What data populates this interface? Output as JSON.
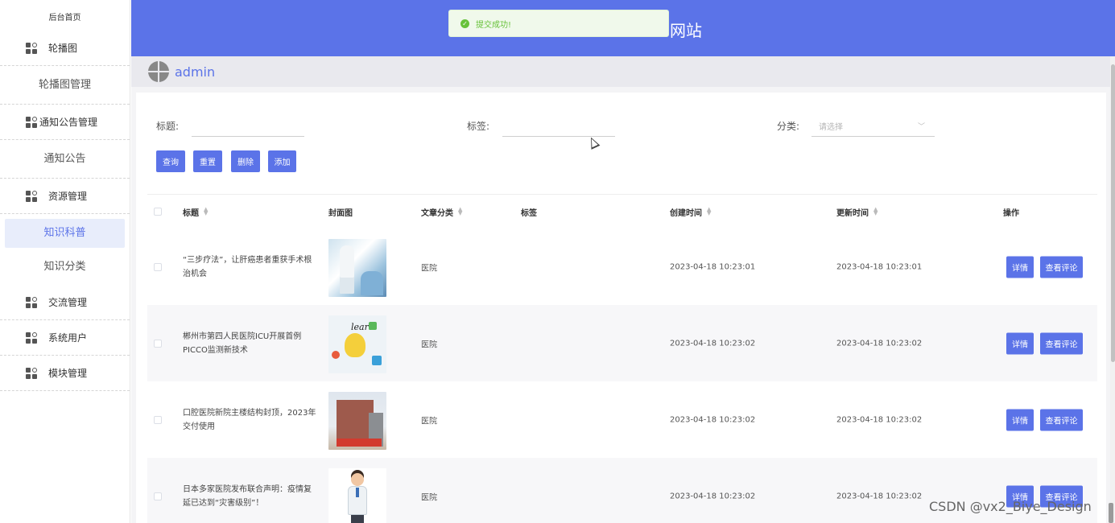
{
  "sidebar": {
    "home": "后台首页",
    "groups": [
      {
        "label": "轮播图",
        "icon": "grid-icon"
      },
      {
        "label": "通知公告管理",
        "icon": "grid-icon"
      },
      {
        "label": "资源管理",
        "icon": "grid-icon"
      },
      {
        "label": "交流管理",
        "icon": "grid-icon"
      },
      {
        "label": "系统用户",
        "icon": "grid-icon"
      },
      {
        "label": "模块管理",
        "icon": "grid-icon"
      }
    ],
    "subs": {
      "carousel_manage": "轮播图管理",
      "notice": "通知公告",
      "knowledge": "知识科普",
      "knowledge_category": "知识分类"
    }
  },
  "header": {
    "site_title": "网站",
    "toast": "提交成功!",
    "username": "admin"
  },
  "filters": {
    "title_label": "标题:",
    "tag_label": "标签:",
    "category_label": "分类:",
    "category_placeholder": "请选择"
  },
  "actions": {
    "query": "查询",
    "reset": "重置",
    "delete": "删除",
    "add": "添加"
  },
  "table": {
    "columns": {
      "title": "标题",
      "cover": "封面图",
      "category": "文章分类",
      "tag": "标签",
      "created": "创建时间",
      "updated": "更新时间",
      "ops": "操作"
    },
    "rows": [
      {
        "title": "“三步疗法”，让肝癌患者重获手术根治机会",
        "category": "医院",
        "tag": "",
        "created": "2023-04-18 10:23:01",
        "updated": "2023-04-18 10:23:01",
        "detail": "详情",
        "comments": "查看评论"
      },
      {
        "title": "郴州市第四人民医院ICU开展首例PICCO监测新技术",
        "category": "医院",
        "tag": "",
        "created": "2023-04-18 10:23:02",
        "updated": "2023-04-18 10:23:02",
        "detail": "详情",
        "comments": "查看评论"
      },
      {
        "title": "口腔医院新院主楼结构封顶，2023年交付使用",
        "category": "医院",
        "tag": "",
        "created": "2023-04-18 10:23:02",
        "updated": "2023-04-18 10:23:02",
        "detail": "详情",
        "comments": "查看评论"
      },
      {
        "title": "日本多家医院发布联合声明：疫情复延已达到“灾害级别”！",
        "category": "医院",
        "tag": "",
        "created": "2023-04-18 10:23:02",
        "updated": "2023-04-18 10:23:02",
        "detail": "详情",
        "comments": "查看评论"
      }
    ]
  },
  "watermark": "CSDN @vx2_Biye_Design",
  "colors": {
    "accent": "#5b73e8",
    "success": "#67c23a"
  }
}
